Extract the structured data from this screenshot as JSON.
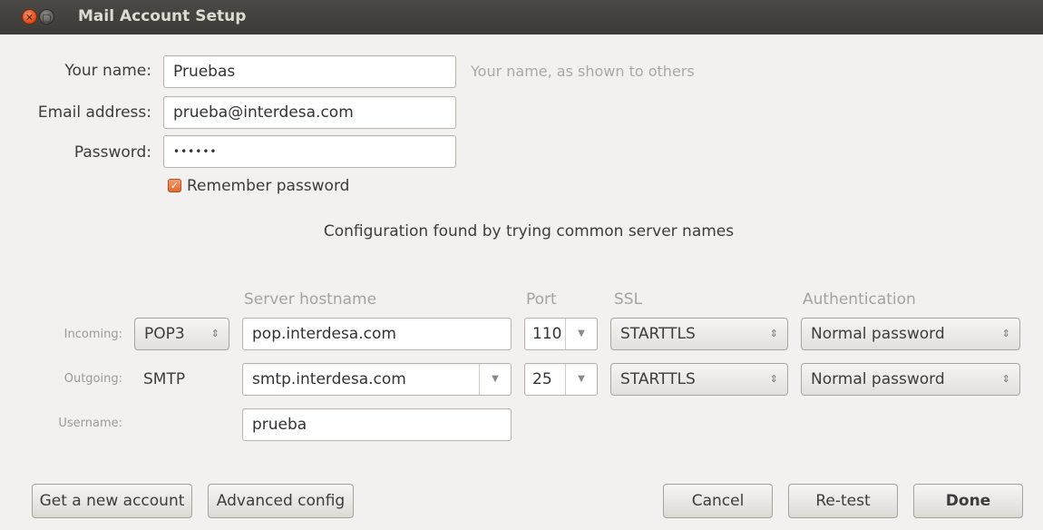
{
  "window": {
    "title": "Mail Account Setup"
  },
  "identity": {
    "name_label": "Your name:",
    "name_value": "Pruebas",
    "name_hint": "Your name, as shown to others",
    "email_label": "Email address:",
    "email_value": "prueba@interdesa.com",
    "password_label": "Password:",
    "password_value": "••••••",
    "remember_label": "Remember password",
    "remember_checked": true
  },
  "status_message": "Configuration found by trying common server names",
  "server": {
    "columns": {
      "hostname": "Server hostname",
      "port": "Port",
      "ssl": "SSL",
      "auth": "Authentication"
    },
    "incoming": {
      "label": "Incoming:",
      "protocol": "POP3",
      "hostname": "pop.interdesa.com",
      "port": "110",
      "ssl": "STARTTLS",
      "auth": "Normal password"
    },
    "outgoing": {
      "label": "Outgoing:",
      "protocol": "SMTP",
      "hostname": "smtp.interdesa.com",
      "port": "25",
      "ssl": "STARTTLS",
      "auth": "Normal password"
    },
    "username": {
      "label": "Username:",
      "value": "prueba"
    }
  },
  "buttons": {
    "new_account": "Get a new account",
    "advanced": "Advanced config",
    "cancel": "Cancel",
    "retest": "Re-test",
    "done": "Done"
  },
  "icons": {
    "close": "close-icon",
    "minimize": "minimize-icon",
    "checkbox": "checkmark-icon",
    "dropdown": "chevron-down-icon",
    "updown": "updown-icon"
  },
  "colors": {
    "accent": "#dd4814",
    "titlebar": "#3c3b37",
    "background": "#f2f1f0"
  }
}
